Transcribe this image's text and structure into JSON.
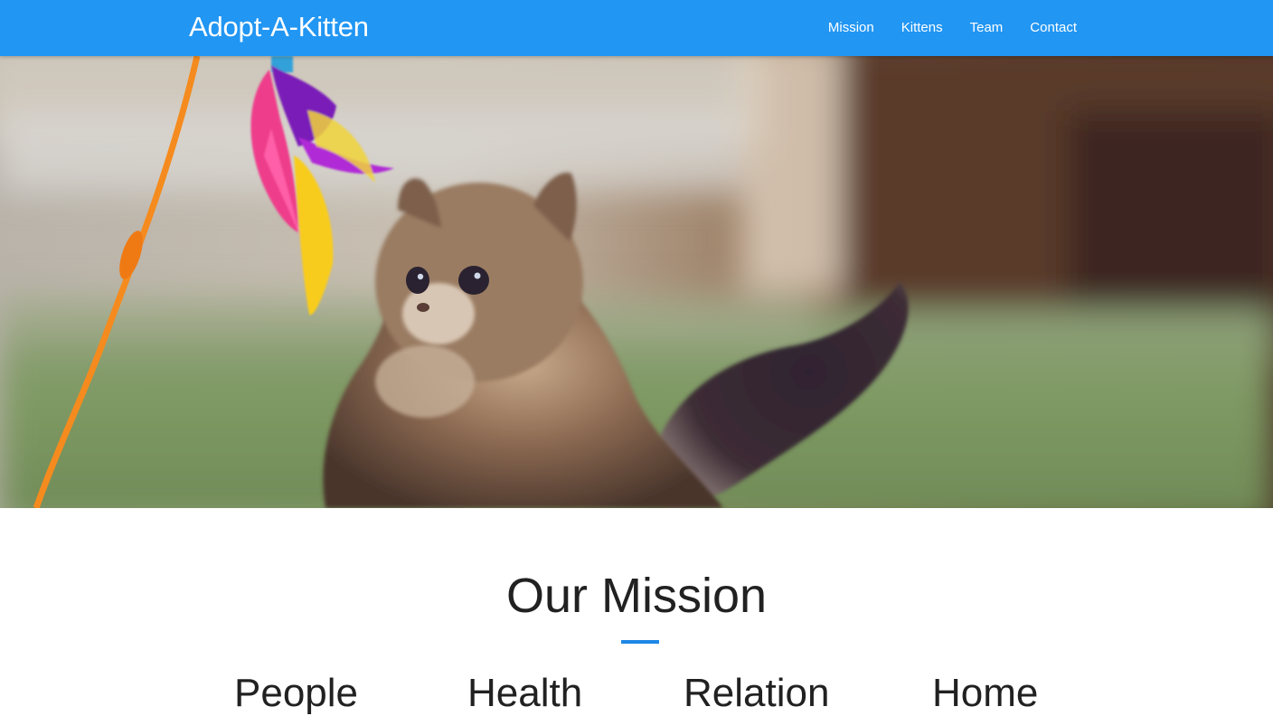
{
  "navbar": {
    "brand": "Adopt-A-Kitten",
    "links": [
      {
        "label": "Mission"
      },
      {
        "label": "Kittens"
      },
      {
        "label": "Team"
      },
      {
        "label": "Contact"
      }
    ],
    "background_color": "#2196f3"
  },
  "hero": {
    "image_subject": "kitten playing with feather toy"
  },
  "mission": {
    "title": "Our Mission",
    "divider_color": "#1e88e5",
    "items": [
      {
        "label": "People"
      },
      {
        "label": "Health"
      },
      {
        "label": "Relation"
      },
      {
        "label": "Home"
      }
    ]
  }
}
